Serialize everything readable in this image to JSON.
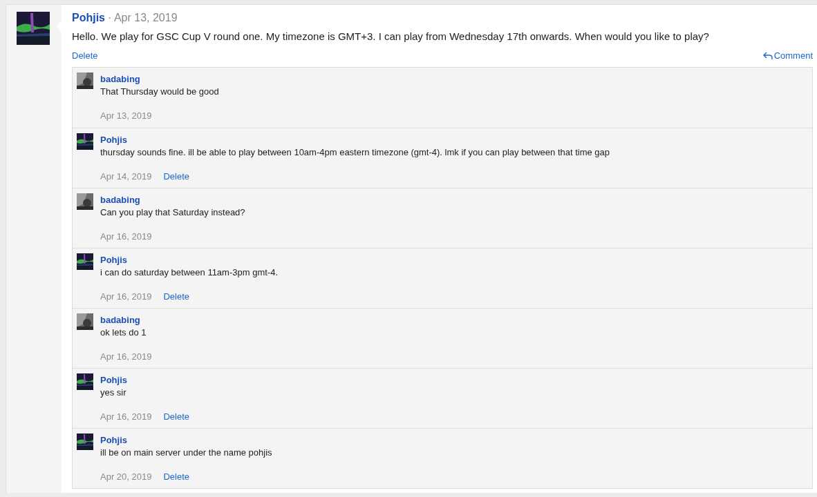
{
  "post": {
    "author": "Pohjis",
    "separator": "·",
    "date": "Apr 13, 2019",
    "text": "Hello. We play for GSC Cup V round one. My timezone is GMT+3. I can play from Wednesday 17th onwards. When would you like to play?",
    "delete": "Delete",
    "comment": "Comment"
  },
  "comments": [
    {
      "author": "badabing",
      "text": "That Thursday would be good",
      "date": "Apr 13, 2019"
    },
    {
      "author": "Pohjis",
      "text": "thursday sounds fine. ill be able to play between 10am-4pm eastern timezone (gmt-4). lmk if you can play between that time gap",
      "date": "Apr 14, 2019",
      "delete": "Delete"
    },
    {
      "author": "badabing",
      "text": "Can you play that Saturday instead?",
      "date": "Apr 16, 2019"
    },
    {
      "author": "Pohjis",
      "text": "i can do saturday between 11am-3pm gmt-4.",
      "date": "Apr 16, 2019",
      "delete": "Delete"
    },
    {
      "author": "badabing",
      "text": "ok lets do 1",
      "date": "Apr 16, 2019"
    },
    {
      "author": "Pohjis",
      "text": "yes sir",
      "date": "Apr 16, 2019",
      "delete": "Delete"
    },
    {
      "author": "Pohjis",
      "text": "ill be on main server under the name pohjis",
      "date": "Apr 20, 2019",
      "delete": "Delete"
    }
  ]
}
